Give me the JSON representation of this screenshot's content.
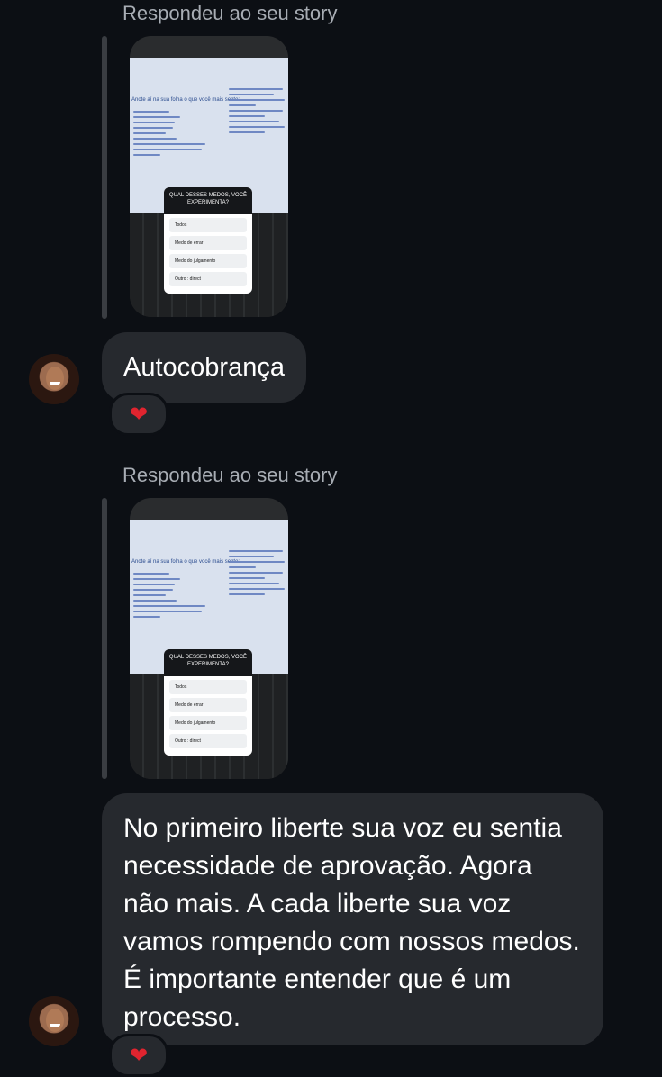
{
  "messages": [
    {
      "reply_label": "Respondeu ao seu story",
      "story": {
        "heading": "Anote aí na sua folha o que você mais sente:",
        "poll_question": "QUAL DESSES MEDOS, VOCÊ EXPERIMENTA?",
        "poll_options": [
          "Todos",
          "Medo de errar",
          "Medo do julgamento",
          "Outro : direct"
        ]
      },
      "text": "Autocobrança",
      "reaction": "❤"
    },
    {
      "reply_label": "Respondeu ao seu story",
      "story": {
        "heading": "Anote aí na sua folha o que você mais sente:",
        "poll_question": "QUAL DESSES MEDOS, VOCÊ EXPERIMENTA?",
        "poll_options": [
          "Todos",
          "Medo de errar",
          "Medo do julgamento",
          "Outro : direct"
        ]
      },
      "text": "No primeiro liberte sua voz eu sentia necessidade de aprovação. Agora não mais. A cada liberte sua voz vamos rompendo com nossos medos. É importante entender que é um processo.",
      "reaction": "❤"
    }
  ],
  "colors": {
    "background": "#0c0f14",
    "bubble": "#26292e",
    "label": "#a8adb4",
    "heart": "#e0242f"
  },
  "icons": {
    "avatar": "user-avatar",
    "reaction": "heart-icon"
  }
}
